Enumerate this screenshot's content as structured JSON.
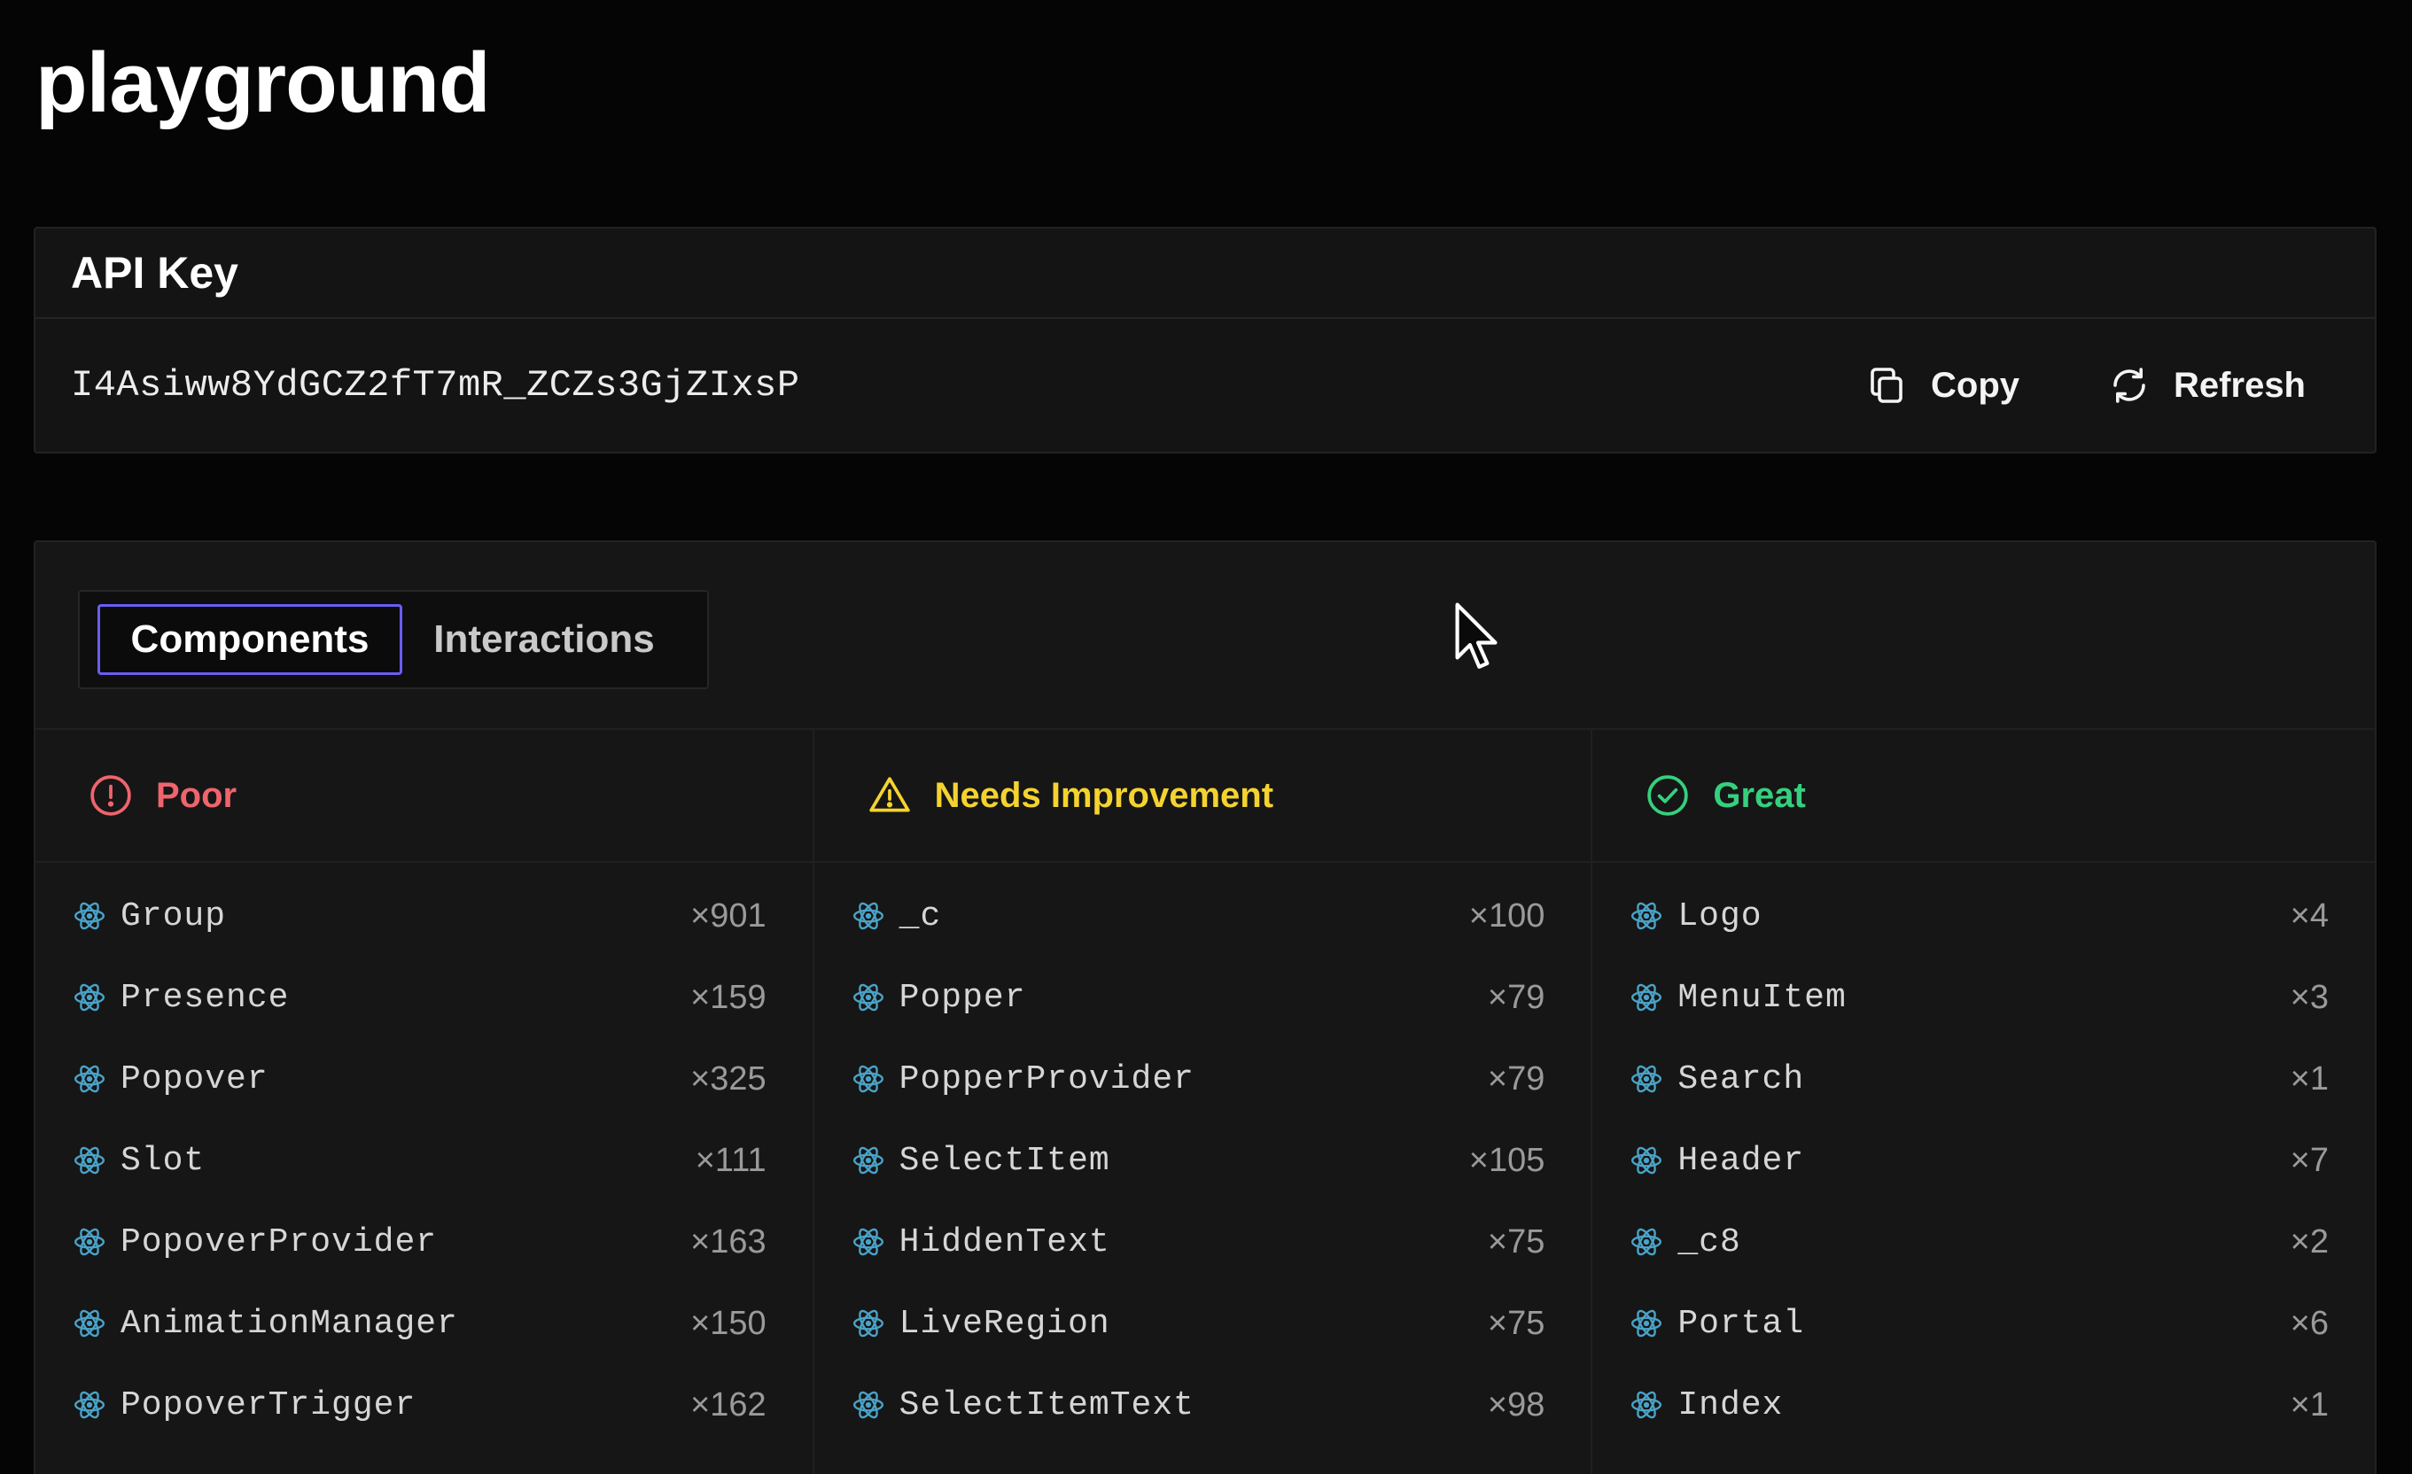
{
  "page": {
    "title": "playground"
  },
  "api_key": {
    "title": "API Key",
    "value": "I4Asiww8YdGCZ2fT7mR_ZCZs3GjZIxsP",
    "copy_label": "Copy",
    "refresh_label": "Refresh"
  },
  "tabs": [
    {
      "label": "Components",
      "active": true
    },
    {
      "label": "Interactions",
      "active": false
    }
  ],
  "colors": {
    "poor": "#f0646d",
    "needs_improvement": "#f5d32f",
    "great": "#35d07f",
    "accent": "#6a5df3",
    "react_icon": "#4aa3c8"
  },
  "columns": [
    {
      "title": "Poor",
      "icon": "alert-circle-icon",
      "items": [
        {
          "name": "Group",
          "count": "×901"
        },
        {
          "name": "Presence",
          "count": "×159"
        },
        {
          "name": "Popover",
          "count": "×325"
        },
        {
          "name": "Slot",
          "count": "×111"
        },
        {
          "name": "PopoverProvider",
          "count": "×163"
        },
        {
          "name": "AnimationManager",
          "count": "×150"
        },
        {
          "name": "PopoverTrigger",
          "count": "×162"
        }
      ]
    },
    {
      "title": "Needs Improvement",
      "icon": "warning-triangle-icon",
      "items": [
        {
          "name": "_c",
          "count": "×100"
        },
        {
          "name": "Popper",
          "count": "×79"
        },
        {
          "name": "PopperProvider",
          "count": "×79"
        },
        {
          "name": "SelectItem",
          "count": "×105"
        },
        {
          "name": "HiddenText",
          "count": "×75"
        },
        {
          "name": "LiveRegion",
          "count": "×75"
        },
        {
          "name": "SelectItemText",
          "count": "×98"
        }
      ]
    },
    {
      "title": "Great",
      "icon": "check-circle-icon",
      "items": [
        {
          "name": "Logo",
          "count": "×4"
        },
        {
          "name": "MenuItem",
          "count": "×3"
        },
        {
          "name": "Search",
          "count": "×1"
        },
        {
          "name": "Header",
          "count": "×7"
        },
        {
          "name": "_c8",
          "count": "×2"
        },
        {
          "name": "Portal",
          "count": "×6"
        },
        {
          "name": "Index",
          "count": "×1"
        }
      ]
    }
  ]
}
